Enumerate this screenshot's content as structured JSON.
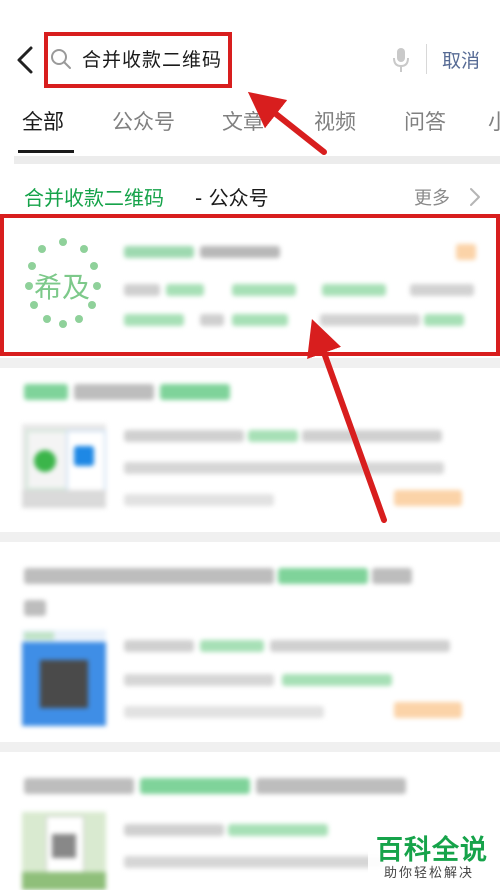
{
  "search": {
    "query": "合并收款二维码",
    "cancel_label": "取消"
  },
  "tabs": [
    {
      "label": "全部",
      "active": true
    },
    {
      "label": "公众号"
    },
    {
      "label": "文章"
    },
    {
      "label": "视频"
    },
    {
      "label": "问答"
    },
    {
      "label": "小"
    }
  ],
  "section": {
    "title_key": "合并收款二维码",
    "title_rest": "- 公众号",
    "more_label": "更多"
  },
  "account": {
    "logo_text": "希及",
    "logo_color": "#7dc98a"
  },
  "colors": {
    "accent_green": "#16a34a",
    "highlight_red": "#d81e1e",
    "link_blue": "#576b95",
    "tag_orange": "#fbd3a8"
  },
  "watermark": {
    "title": "百科全说",
    "subtitle": "助你轻松解决"
  }
}
